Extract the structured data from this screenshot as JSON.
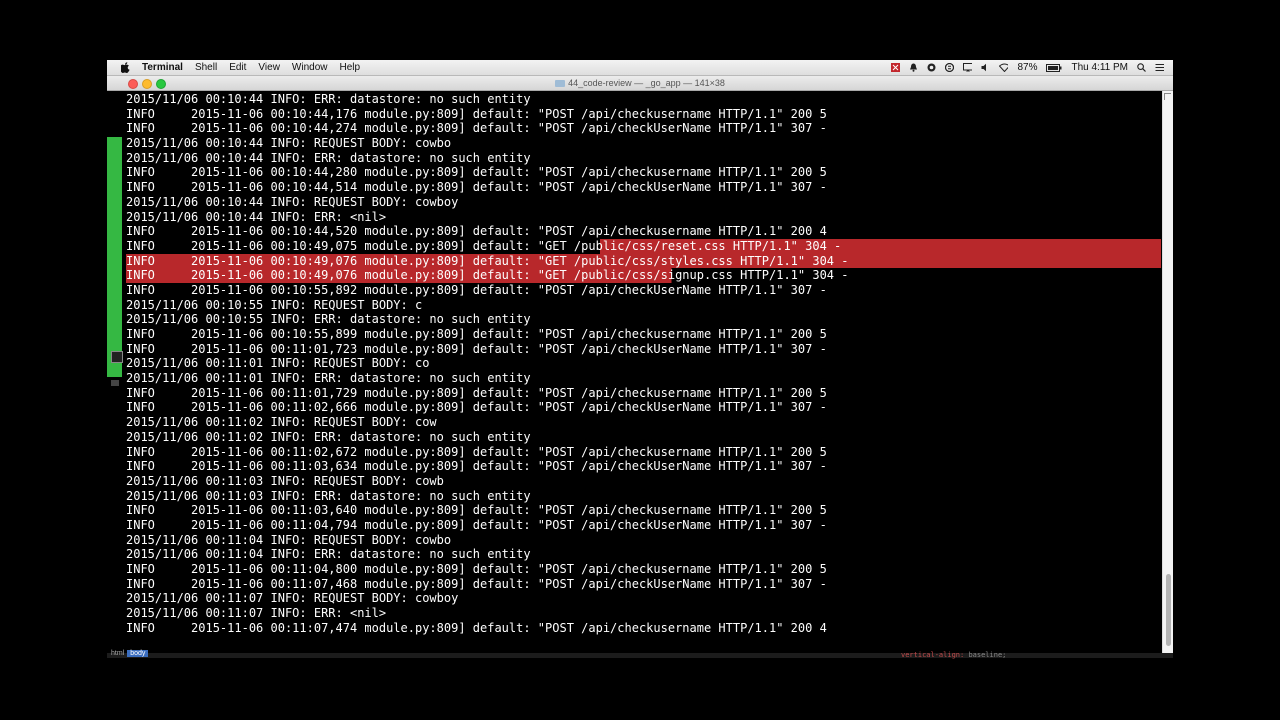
{
  "menubar": {
    "apple_icon": "apple-icon",
    "items": [
      "Terminal",
      "Shell",
      "Edit",
      "View",
      "Window",
      "Help"
    ],
    "status": {
      "battery": "87%",
      "clock": "Thu 4:11 PM"
    },
    "status_icons": [
      "app-red-icon",
      "bell-icon",
      "security-icon",
      "skype-icon",
      "screen-icon",
      "speaker-icon",
      "wifi-icon",
      "battery-icon",
      "search-icon",
      "list-icon"
    ]
  },
  "window": {
    "title": "44_code-review — _go_app — 141×38"
  },
  "terminal": {
    "lines": [
      {
        "text": "2015/11/06 00:10:44 INFO: ERR: datastore: no such entity",
        "hl": false
      },
      {
        "text": "INFO     2015-11-06 00:10:44,176 module.py:809] default: \"POST /api/checkusername HTTP/1.1\" 200 5",
        "hl": false
      },
      {
        "text": "INFO     2015-11-06 00:10:44,274 module.py:809] default: \"POST /api/checkUserName HTTP/1.1\" 307 -",
        "hl": false
      },
      {
        "text": "2015/11/06 00:10:44 INFO: REQUEST BODY: cowbo",
        "hl": false
      },
      {
        "text": "2015/11/06 00:10:44 INFO: ERR: datastore: no such entity",
        "hl": false
      },
      {
        "text": "INFO     2015-11-06 00:10:44,280 module.py:809] default: \"POST /api/checkusername HTTP/1.1\" 200 5",
        "hl": false
      },
      {
        "text": "INFO     2015-11-06 00:10:44,514 module.py:809] default: \"POST /api/checkUserName HTTP/1.1\" 307 -",
        "hl": false
      },
      {
        "text": "2015/11/06 00:10:44 INFO: REQUEST BODY: cowboy",
        "hl": false
      },
      {
        "text": "2015/11/06 00:10:44 INFO: ERR: <nil>",
        "hl": false
      },
      {
        "text": "INFO     2015-11-06 00:10:44,520 module.py:809] default: \"POST /api/checkusername HTTP/1.1\" 200 4",
        "hl": false
      },
      {
        "text": "INFO     2015-11-06 00:10:49,075 module.py:809] default: \"GET /public/css/reset.css HTTP/1.1\" 304 -",
        "hl": "partial"
      },
      {
        "text": "INFO     2015-11-06 00:10:49,076 module.py:809] default: \"GET /public/css/styles.css HTTP/1.1\" 304 -",
        "hl": true
      },
      {
        "text": "INFO     2015-11-06 00:10:49,076 module.py:809] default: \"GET /public/css/signup.css HTTP/1.1\" 304 -",
        "hl": "partial-left"
      },
      {
        "text": "INFO     2015-11-06 00:10:55,892 module.py:809] default: \"POST /api/checkUserName HTTP/1.1\" 307 -",
        "hl": false
      },
      {
        "text": "2015/11/06 00:10:55 INFO: REQUEST BODY: c",
        "hl": false
      },
      {
        "text": "2015/11/06 00:10:55 INFO: ERR: datastore: no such entity",
        "hl": false
      },
      {
        "text": "INFO     2015-11-06 00:10:55,899 module.py:809] default: \"POST /api/checkusername HTTP/1.1\" 200 5",
        "hl": false
      },
      {
        "text": "INFO     2015-11-06 00:11:01,723 module.py:809] default: \"POST /api/checkUserName HTTP/1.1\" 307 -",
        "hl": false
      },
      {
        "text": "2015/11/06 00:11:01 INFO: REQUEST BODY: co",
        "hl": false
      },
      {
        "text": "2015/11/06 00:11:01 INFO: ERR: datastore: no such entity",
        "hl": false
      },
      {
        "text": "INFO     2015-11-06 00:11:01,729 module.py:809] default: \"POST /api/checkusername HTTP/1.1\" 200 5",
        "hl": false
      },
      {
        "text": "INFO     2015-11-06 00:11:02,666 module.py:809] default: \"POST /api/checkUserName HTTP/1.1\" 307 -",
        "hl": false
      },
      {
        "text": "2015/11/06 00:11:02 INFO: REQUEST BODY: cow",
        "hl": false
      },
      {
        "text": "2015/11/06 00:11:02 INFO: ERR: datastore: no such entity",
        "hl": false
      },
      {
        "text": "INFO     2015-11-06 00:11:02,672 module.py:809] default: \"POST /api/checkusername HTTP/1.1\" 200 5",
        "hl": false
      },
      {
        "text": "INFO     2015-11-06 00:11:03,634 module.py:809] default: \"POST /api/checkUserName HTTP/1.1\" 307 -",
        "hl": false
      },
      {
        "text": "2015/11/06 00:11:03 INFO: REQUEST BODY: cowb",
        "hl": false
      },
      {
        "text": "2015/11/06 00:11:03 INFO: ERR: datastore: no such entity",
        "hl": false
      },
      {
        "text": "INFO     2015-11-06 00:11:03,640 module.py:809] default: \"POST /api/checkusername HTTP/1.1\" 200 5",
        "hl": false
      },
      {
        "text": "INFO     2015-11-06 00:11:04,794 module.py:809] default: \"POST /api/checkUserName HTTP/1.1\" 307 -",
        "hl": false
      },
      {
        "text": "2015/11/06 00:11:04 INFO: REQUEST BODY: cowbo",
        "hl": false
      },
      {
        "text": "2015/11/06 00:11:04 INFO: ERR: datastore: no such entity",
        "hl": false
      },
      {
        "text": "INFO     2015-11-06 00:11:04,800 module.py:809] default: \"POST /api/checkusername HTTP/1.1\" 200 5",
        "hl": false
      },
      {
        "text": "INFO     2015-11-06 00:11:07,468 module.py:809] default: \"POST /api/checkUserName HTTP/1.1\" 307 -",
        "hl": false
      },
      {
        "text": "2015/11/06 00:11:07 INFO: REQUEST BODY: cowboy",
        "hl": false
      },
      {
        "text": "2015/11/06 00:11:07 INFO: ERR: <nil>",
        "hl": false
      },
      {
        "text": "INFO     2015-11-06 00:11:07,474 module.py:809] default: \"POST /api/checkusername HTTP/1.1\" 200 4",
        "hl": false
      }
    ],
    "highlight_color": "#b8282b",
    "marker_color": "#35b843"
  },
  "bottom_strip": {
    "crumb": "html",
    "crumb_selected": "body",
    "code_prop": "vertical-align",
    "code_value": "baseline;"
  }
}
